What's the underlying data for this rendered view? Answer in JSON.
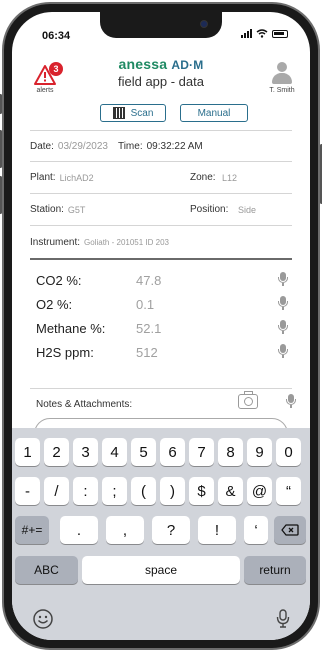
{
  "status_bar": {
    "time": "06:34"
  },
  "header": {
    "alerts_count": "3",
    "alerts_label": "alerts",
    "brand_name": "anessa",
    "brand_suffix": "AD·M",
    "app_title": "field app - data",
    "user_name": "T. Smith"
  },
  "mode": {
    "scan_label": "Scan",
    "manual_label": "Manual"
  },
  "info": {
    "date_label": "Date:",
    "date_value": "03/29/2023",
    "time_label": "Time:",
    "time_value": "09:32:22 AM",
    "plant_label": "Plant:",
    "plant_value": "LichAD2",
    "zone_label": "Zone:",
    "zone_value": "L12",
    "station_label": "Station:",
    "station_value": "G5T",
    "position_label": "Position:",
    "position_value": "Side",
    "instrument_label": "Instrument:",
    "instrument_value": "Goliath - 201051  ID 203"
  },
  "readings": [
    {
      "label": "CO2 %:",
      "value": "47.8"
    },
    {
      "label": "O2 %:",
      "value": "0.1"
    },
    {
      "label": "Methane %:",
      "value": "52.1"
    },
    {
      "label": "H2S ppm:",
      "value": "512"
    }
  ],
  "notes": {
    "label": "Notes & Attachments:"
  },
  "keyboard": {
    "row1": [
      "1",
      "2",
      "3",
      "4",
      "5",
      "6",
      "7",
      "8",
      "9",
      "0"
    ],
    "row2": [
      "-",
      "/",
      ":",
      ";",
      "(",
      ")",
      "$",
      "&",
      "@",
      "“"
    ],
    "row3": [
      "#+=",
      ".",
      ",",
      "?",
      "!",
      "‘"
    ],
    "abc": "ABC",
    "space": "space",
    "return": "return"
  }
}
